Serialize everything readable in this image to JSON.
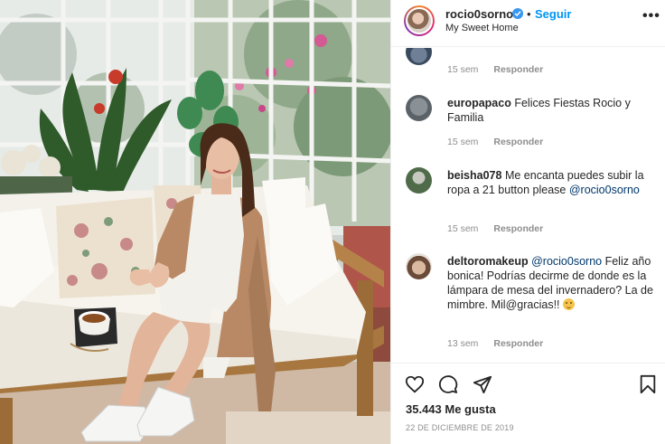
{
  "post": {
    "username": "rocio0sorno",
    "follow_label": "Seguir",
    "separator": "•",
    "location": "My Sweet Home",
    "more_label": "•••",
    "likes_text": "35.443 Me gusta",
    "date": "22 DE DICIEMBRE DE 2019"
  },
  "comments": [
    {
      "user": "",
      "text": "",
      "time": "15 sem",
      "reply": "Responder"
    },
    {
      "user": "europapaco",
      "text": "Felices Fiestas Rocio y Familia",
      "time": "15 sem",
      "reply": "Responder"
    },
    {
      "user": "beisha078",
      "text": "Me encanta puedes subir la ropa a 21 button please",
      "mention": "@rocio0sorno",
      "time": "15 sem",
      "reply": "Responder"
    },
    {
      "user": "deltoromakeup",
      "mention": "@rocio0sorno",
      "text": "Feliz año bonica! Podrías decirme de donde es la lámpara de mesa del invernadero? La de mimbre. Mil@gracias!!",
      "time": "13 sem",
      "reply": "Responder"
    }
  ],
  "icons": {
    "verified": "verified-badge-icon",
    "like": "heart-icon",
    "comment": "comment-bubble-icon",
    "share": "paper-plane-icon",
    "save": "bookmark-icon",
    "more": "more-dots-icon"
  },
  "colors": {
    "link_blue": "#0095f6",
    "mention_blue": "#00376b",
    "meta_gray": "#8e8e8e",
    "text": "#262626"
  }
}
